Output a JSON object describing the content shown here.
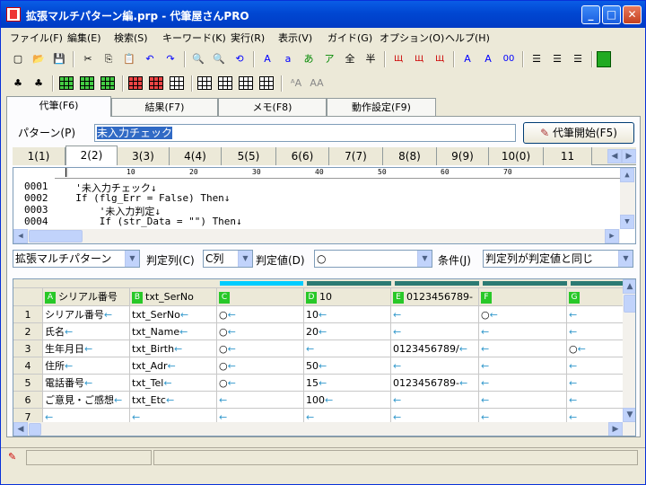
{
  "window": {
    "title": "拡張マルチパターン編.prp - 代筆屋さんPRO",
    "min": "_",
    "max": "□",
    "close": "✕"
  },
  "menu": [
    "ファイル(F)",
    "編集(E)",
    "検索(S)",
    "キーワード(K)",
    "実行(R)",
    "表示(V)",
    "ガイド(G)",
    "オプション(O)",
    "ヘルプ(H)"
  ],
  "toolbar1": [
    {
      "name": "new-icon",
      "glyph": "▢"
    },
    {
      "name": "open-icon",
      "glyph": "📂"
    },
    {
      "name": "save-icon",
      "glyph": "💾"
    },
    {
      "name": "cut-icon",
      "glyph": "✂"
    },
    {
      "name": "copy-icon",
      "glyph": "⎘"
    },
    {
      "name": "paste-icon",
      "glyph": "📋"
    },
    {
      "name": "undo-icon",
      "glyph": "↶"
    },
    {
      "name": "redo-icon",
      "glyph": "↷"
    },
    {
      "name": "find-icon",
      "glyph": "🔍"
    },
    {
      "name": "find-next-icon",
      "glyph": "🔍"
    },
    {
      "name": "replace-icon",
      "glyph": "⟲"
    },
    {
      "name": "fullwidth-alpha-icon",
      "glyph": "A"
    },
    {
      "name": "halfwidth-alpha-icon",
      "glyph": "a"
    },
    {
      "name": "hiragana-icon",
      "glyph": "あ"
    },
    {
      "name": "katakana-icon",
      "glyph": "ア"
    },
    {
      "name": "fullwidth-icon",
      "glyph": "全"
    },
    {
      "name": "halfwidth-icon",
      "glyph": "半"
    }
  ],
  "tabs": {
    "main": [
      "代筆(F6)",
      "結果(F7)",
      "メモ(F8)",
      "動作設定(F9)"
    ]
  },
  "pattern": {
    "label": "パターン(P)",
    "value": "未入力チェック",
    "start_button": "代筆開始(F5)"
  },
  "number_tabs": [
    "1(1)",
    "2(2)",
    "3(3)",
    "4(4)",
    "5(5)",
    "6(6)",
    "7(7)",
    "8(8)",
    "9(9)",
    "10(0)",
    "11"
  ],
  "ruler": [
    "10",
    "20",
    "30",
    "40",
    "50",
    "60",
    "70"
  ],
  "code": [
    {
      "num": "0001",
      "text": "  '未入力チェック↓"
    },
    {
      "num": "0002",
      "text": "  If (flg_Err = False) Then↓"
    },
    {
      "num": "0003",
      "text": "      '未入力判定↓"
    },
    {
      "num": "0004",
      "text": "      If (str_Data = \"\") Then↓"
    }
  ],
  "filter": {
    "pattern_select": "拡張マルチパターン",
    "judge_col_label": "判定列(C)",
    "judge_col_value": "C列",
    "judge_val_label": "判定値(D)",
    "judge_val_value": "○",
    "cond_label": "条件(J)",
    "cond_value": "判定列が判定値と同じ"
  },
  "grid": {
    "columns": [
      {
        "letter": "A",
        "header": "シリアル番号"
      },
      {
        "letter": "B",
        "header": "txt_SerNo"
      },
      {
        "letter": "C",
        "header": ""
      },
      {
        "letter": "D",
        "header": "10"
      },
      {
        "letter": "E",
        "header": "0123456789-"
      },
      {
        "letter": "F",
        "header": ""
      },
      {
        "letter": "G",
        "header": ""
      }
    ],
    "rows": [
      {
        "n": "1",
        "cells": [
          "シリアル番号",
          "txt_SerNo",
          "○",
          "10",
          "",
          "○",
          ""
        ]
      },
      {
        "n": "2",
        "cells": [
          "氏名",
          "txt_Name",
          "○",
          "20",
          "",
          "",
          ""
        ]
      },
      {
        "n": "3",
        "cells": [
          "生年月日",
          "txt_Birth",
          "○",
          "",
          "0123456789/",
          "",
          "○"
        ]
      },
      {
        "n": "4",
        "cells": [
          "住所",
          "txt_Adr",
          "○",
          "50",
          "",
          "",
          ""
        ]
      },
      {
        "n": "5",
        "cells": [
          "電話番号",
          "txt_Tel",
          "○",
          "15",
          "0123456789-",
          "",
          ""
        ]
      },
      {
        "n": "6",
        "cells": [
          "ご意見・ご感想",
          "txt_Etc",
          "",
          "100",
          "",
          "",
          ""
        ]
      },
      {
        "n": "7",
        "cells": [
          "",
          "",
          "",
          "",
          "",
          "",
          ""
        ]
      }
    ]
  }
}
